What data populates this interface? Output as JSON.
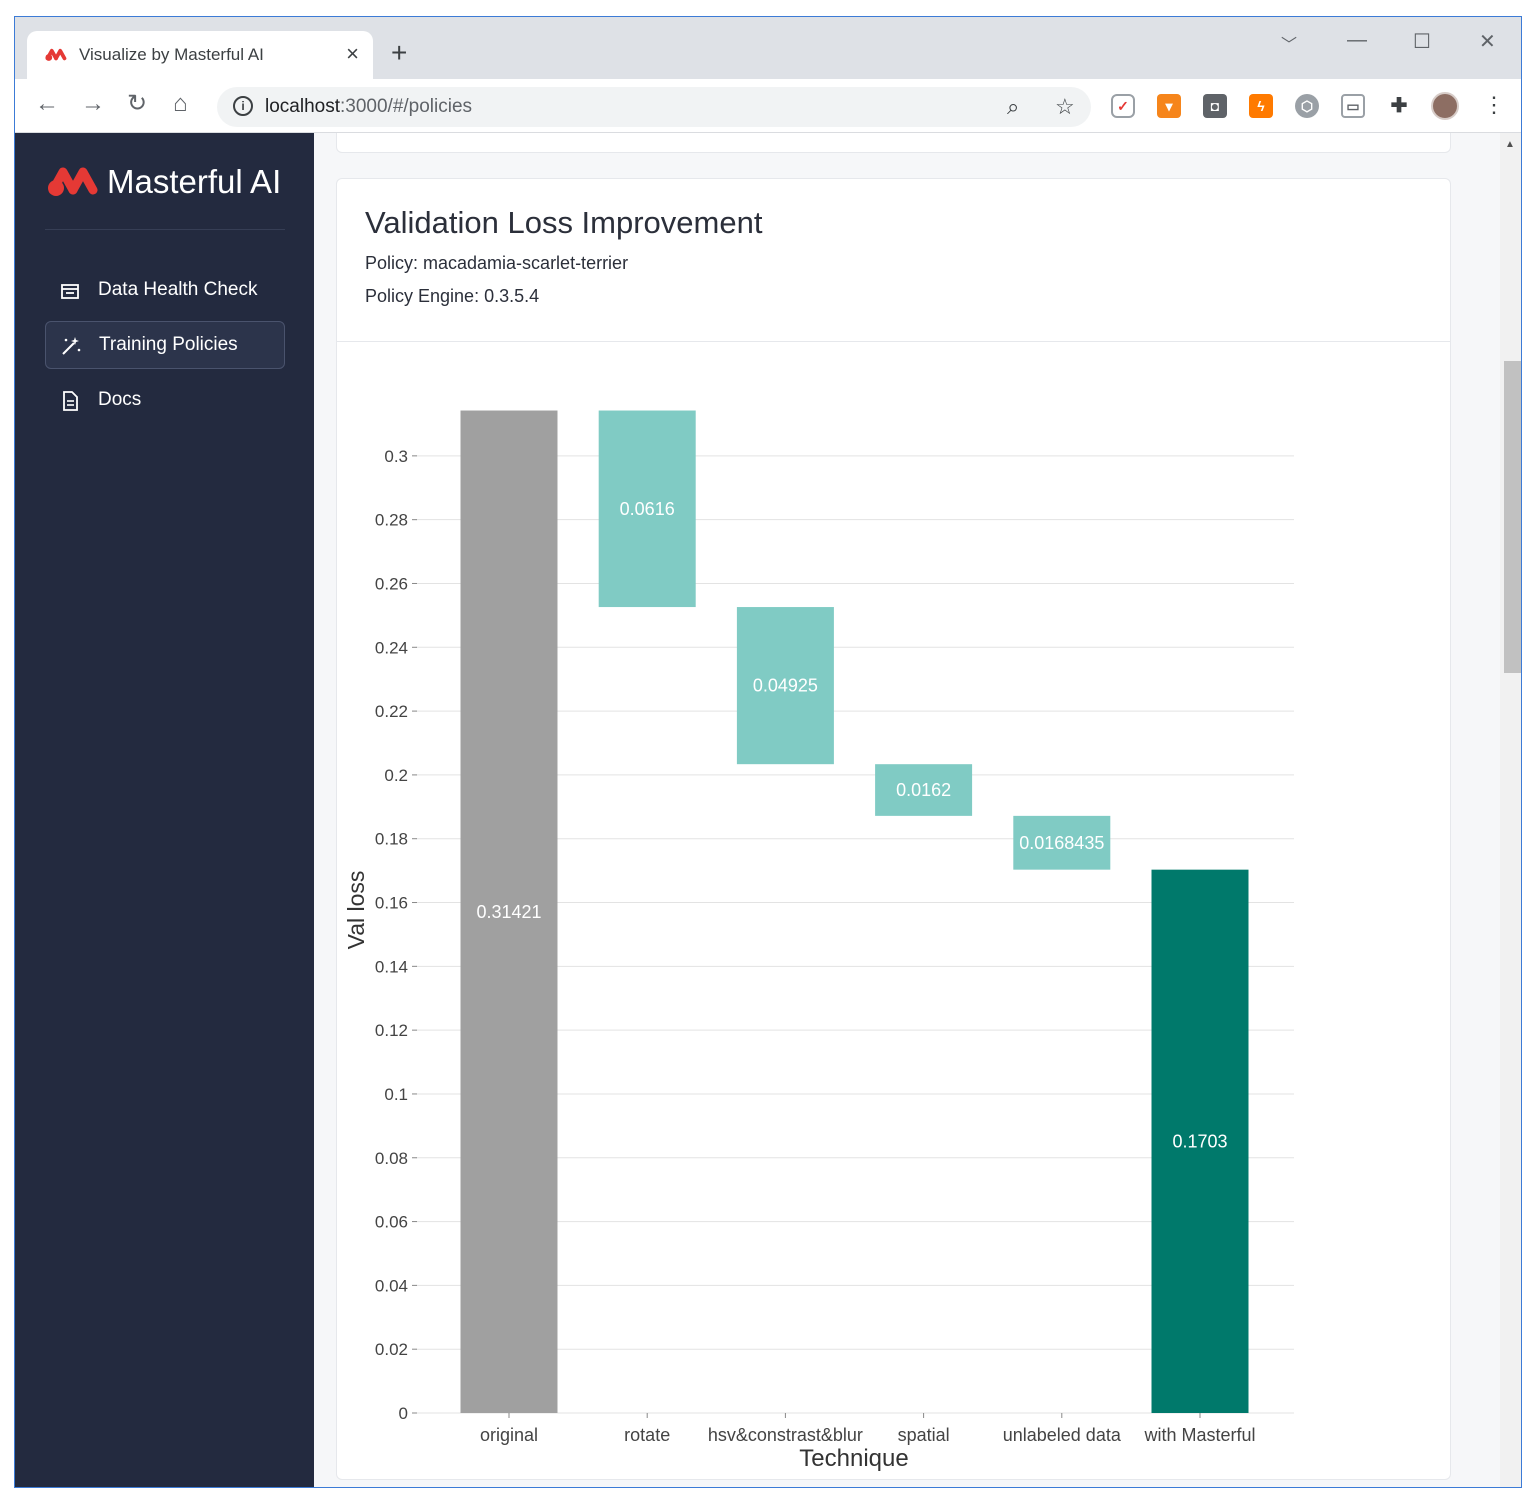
{
  "browser": {
    "tab_title": "Visualize by Masterful AI",
    "url_host": "localhost",
    "url_path": ":3000/#/policies"
  },
  "sidebar": {
    "brand": "Masterful AI",
    "items": [
      {
        "label": "Data Health Check",
        "icon": "folder-icon",
        "active": false
      },
      {
        "label": "Training Policies",
        "icon": "magic-wand-icon",
        "active": true
      },
      {
        "label": "Docs",
        "icon": "document-icon",
        "active": false
      }
    ]
  },
  "card": {
    "title": "Validation Loss Improvement",
    "policy": "Policy: macadamia-scarlet-terrier",
    "engine": "Policy Engine: 0.3.5.4"
  },
  "colors": {
    "sidebar_bg": "#232a3f",
    "original_bar": "#a0a0a0",
    "step_bar": "#80cbc4",
    "final_bar": "#00796b",
    "brand_red": "#e53935"
  },
  "chart_data": {
    "type": "bar",
    "subtype": "waterfall",
    "xlabel": "Technique",
    "ylabel": "Val loss",
    "ylim": [
      0,
      0.315
    ],
    "yticks": [
      0,
      0.02,
      0.04,
      0.06,
      0.08,
      0.1,
      0.12,
      0.14,
      0.16,
      0.18,
      0.2,
      0.22,
      0.24,
      0.26,
      0.28,
      0.3
    ],
    "ytick_labels": [
      "0",
      "0.02",
      "0.04",
      "0.06",
      "0.08",
      "0.1",
      "0.12",
      "0.14",
      "0.16",
      "0.18",
      "0.2",
      "0.22",
      "0.24",
      "0.26",
      "0.28",
      "0.3"
    ],
    "grid": true,
    "bars": [
      {
        "category": "original",
        "start": 0,
        "end": 0.31421,
        "label": "0.31421",
        "kind": "total"
      },
      {
        "category": "rotate",
        "start": 0.31421,
        "end": 0.25261,
        "label": "0.0616",
        "kind": "step"
      },
      {
        "category": "hsv&constrast&blur",
        "start": 0.25261,
        "end": 0.20336,
        "label": "0.04925",
        "kind": "step"
      },
      {
        "category": "spatial",
        "start": 0.20336,
        "end": 0.18716,
        "label": "0.0162",
        "kind": "step"
      },
      {
        "category": "unlabeled data",
        "start": 0.18716,
        "end": 0.1703,
        "label": "0.0168435",
        "kind": "step"
      },
      {
        "category": "with Masterful",
        "start": 0,
        "end": 0.1703,
        "label": "0.1703",
        "kind": "final"
      }
    ]
  }
}
